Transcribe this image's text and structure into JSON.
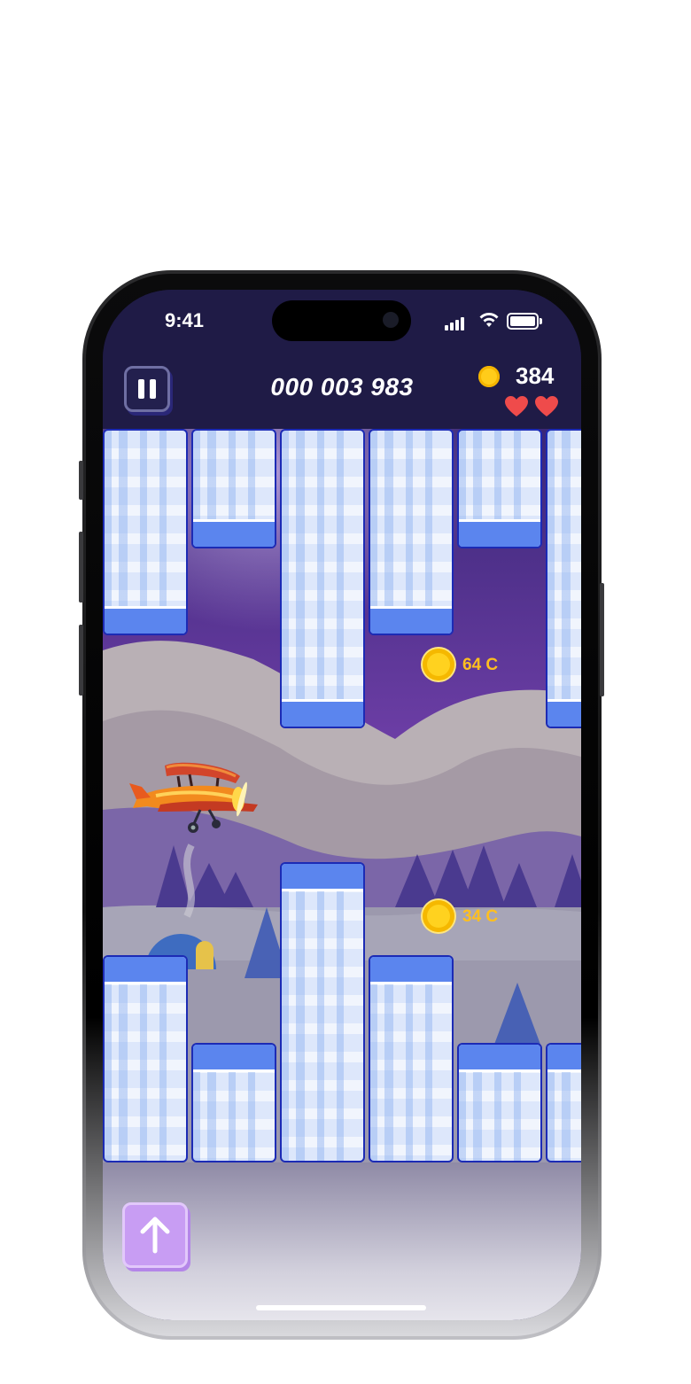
{
  "status_bar": {
    "time": "9:41"
  },
  "hud": {
    "score": "000 003 983",
    "coins": "384",
    "lives": 2
  },
  "game": {
    "coin_pickups": [
      {
        "label": "64 C"
      },
      {
        "label": "34 C"
      }
    ]
  },
  "colors": {
    "background": "#1f1b46",
    "pillar_band": "#5b85ee",
    "coin": "#ffcc1a",
    "heart": "#ef4b4b",
    "up_button": "#c89df3"
  },
  "icons": [
    "pause-icon",
    "coin-icon",
    "heart-icon",
    "airplane-icon",
    "arrow-up-icon",
    "signal-icon",
    "wifi-icon",
    "battery-icon"
  ]
}
